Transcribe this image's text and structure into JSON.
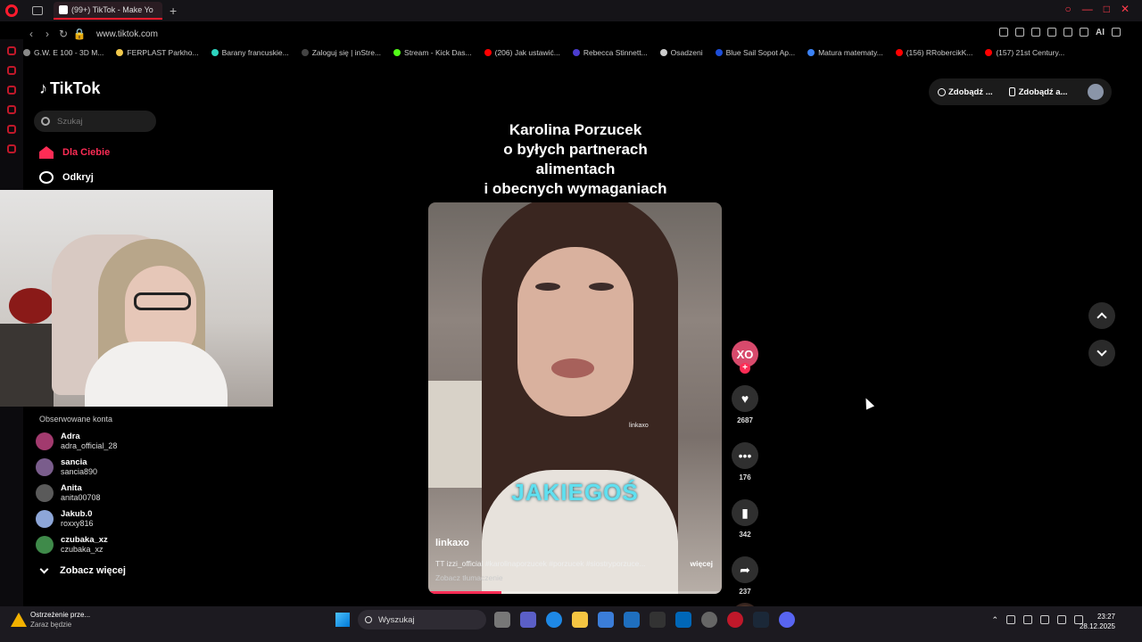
{
  "browser": {
    "tab_title": "(99+) TikTok - Make Yo",
    "url": "www.tiktok.com",
    "bookmarks": [
      "G.W. E 100 - 3D M...",
      "FERPLAST Parkho...",
      "Barany francuskie...",
      "Zaloguj się | inStre...",
      "Stream - Kick Das...",
      "(206) Jak ustawić...",
      "Rebecca Stinnett...",
      "Osadzeni",
      "Blue Sail Sopot Ap...",
      "Matura matematy...",
      "(156) RRobercikK...",
      "(157) 21st Century..."
    ],
    "ai_label": "AI"
  },
  "tiktok": {
    "logo": "TikTok",
    "search_placeholder": "Szukaj",
    "nav": {
      "for_you": "Dla Ciebie",
      "explore": "Odkryj"
    },
    "followed_title": "Obserwowane konta",
    "followed": [
      {
        "name": "Adra",
        "handle": "adra_official_28",
        "color": "#a23a6e"
      },
      {
        "name": "sancia",
        "handle": "sancia890",
        "color": "#7a5d8c"
      },
      {
        "name": "Anita",
        "handle": "anita00708",
        "color": "#5a5a5a"
      },
      {
        "name": "Jakub.0",
        "handle": "roxxy816",
        "color": "#8da6d8"
      },
      {
        "name": "czubaka_xz",
        "handle": "czubaka_xz",
        "color": "#3f8a4a"
      }
    ],
    "see_more": "Zobacz więcej",
    "top_actions": {
      "coins": "Zdobądź ...",
      "app": "Zdobądź a..."
    }
  },
  "video": {
    "caption": [
      "Karolina Porzucek",
      "o byłych partnerach",
      "alimentach",
      "i obecnych wymaganiach"
    ],
    "overlay_text": "JAKIEGOŚ",
    "watermark": "linkaxo",
    "author": "linkaxo",
    "description": "TT izzi_official #karolinaporzucek #porzucek #siostryporzuce...",
    "more": "więcej",
    "translate": "Zobacz tłumaczenie",
    "progress": 0.25,
    "creator_initials": "XO",
    "likes": "2687",
    "comments": "176",
    "saves": "342",
    "shares": "237"
  },
  "taskbar": {
    "warning_title": "Ostrzeżenie prze...",
    "warning_sub": "Zaraz będzie",
    "search": "Wyszukaj",
    "time": "23:27",
    "date": "28.12.2025"
  },
  "colors": {
    "accent": "#fe2c55",
    "opera_red": "#ff1b2d",
    "overlay_cyan": "#5fe0f0"
  }
}
